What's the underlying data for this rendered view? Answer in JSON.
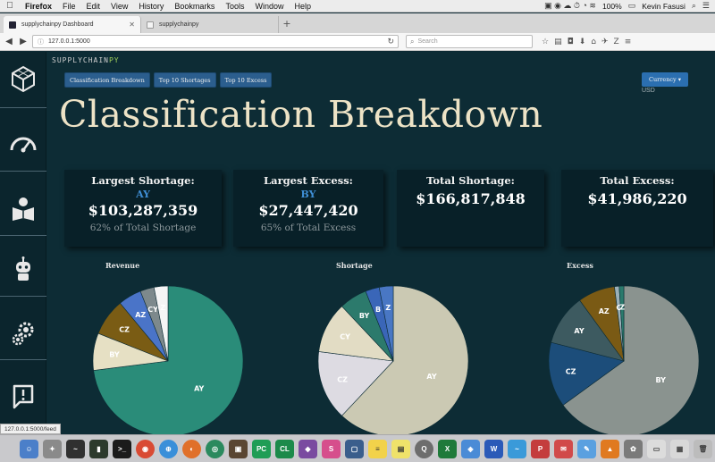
{
  "menubar": {
    "app": "Firefox",
    "items": [
      "File",
      "Edit",
      "View",
      "History",
      "Bookmarks",
      "Tools",
      "Window",
      "Help"
    ],
    "battery": "100%",
    "user": "Kevin Fasusi"
  },
  "tabs": [
    {
      "label": "supplychainpy Dashboard"
    },
    {
      "label": "supplychainpy"
    }
  ],
  "browser": {
    "url": "127.0.0.1:5000",
    "search_placeholder": "Search"
  },
  "app": {
    "brand_main": "SUPPLYCHAIN",
    "brand_accent": "PY",
    "nav": [
      {
        "label": "Classification Breakdown"
      },
      {
        "label": "Top 10 Shortages"
      },
      {
        "label": "Top 10 Excess"
      }
    ],
    "currency_button": "Currency ▾",
    "currency_value": "USD",
    "title": "Classification Breakdown"
  },
  "cards": [
    {
      "label": "Largest Shortage:",
      "class": "AY",
      "value": "$103,287,359",
      "percent": "62% of Total Shortage"
    },
    {
      "label": "Largest Excess:",
      "class": "BY",
      "value": "$27,447,420",
      "percent": "65% of Total Excess"
    },
    {
      "label": "Total Shortage:",
      "value": "$166,817,848"
    },
    {
      "label": "Total Excess:",
      "value": "$41,986,220"
    }
  ],
  "chart_data": [
    {
      "type": "pie",
      "title": "Revenue",
      "slices": [
        {
          "label": "AY",
          "value": 0.73,
          "color": "#2a8c79"
        },
        {
          "label": "BY",
          "value": 0.08,
          "color": "#e6e0c4"
        },
        {
          "label": "CZ",
          "value": 0.08,
          "color": "#7a5c14"
        },
        {
          "label": "AZ",
          "value": 0.05,
          "color": "#4a74c8"
        },
        {
          "label": "CY",
          "value": 0.03,
          "color": "#7d898c"
        },
        {
          "label": "Z",
          "value": 0.03,
          "color": "#f5f5f5"
        }
      ]
    },
    {
      "type": "pie",
      "title": "Shortage",
      "slices": [
        {
          "label": "AY",
          "value": 0.62,
          "color": "#cbc9b3"
        },
        {
          "label": "CZ",
          "value": 0.15,
          "color": "#dddbe2"
        },
        {
          "label": "CY",
          "value": 0.11,
          "color": "#e2dcc4"
        },
        {
          "label": "BY",
          "value": 0.06,
          "color": "#2c7a6c"
        },
        {
          "label": "B",
          "value": 0.03,
          "color": "#3a66b8"
        },
        {
          "label": "Z",
          "value": 0.03,
          "color": "#4977c4"
        }
      ]
    },
    {
      "type": "pie",
      "title": "Excess",
      "slices": [
        {
          "label": "BY",
          "value": 0.65,
          "color": "#8a938f"
        },
        {
          "label": "CZ",
          "value": 0.14,
          "color": "#1c4d7a"
        },
        {
          "label": "AY",
          "value": 0.11,
          "color": "#3d5a60"
        },
        {
          "label": "AZ",
          "value": 0.08,
          "color": "#7a5a14"
        },
        {
          "label": "C",
          "value": 0.01,
          "color": "#9bb0b8"
        },
        {
          "label": "Z",
          "value": 0.01,
          "color": "#2a7a6c"
        }
      ]
    }
  ],
  "status_url": "127.0.0.1:5000/feed",
  "colors": {
    "background": "#0d2c35",
    "title": "#ede3c6",
    "accent_blue": "#3f8fd6",
    "nav_button": "#2b5e8e"
  }
}
